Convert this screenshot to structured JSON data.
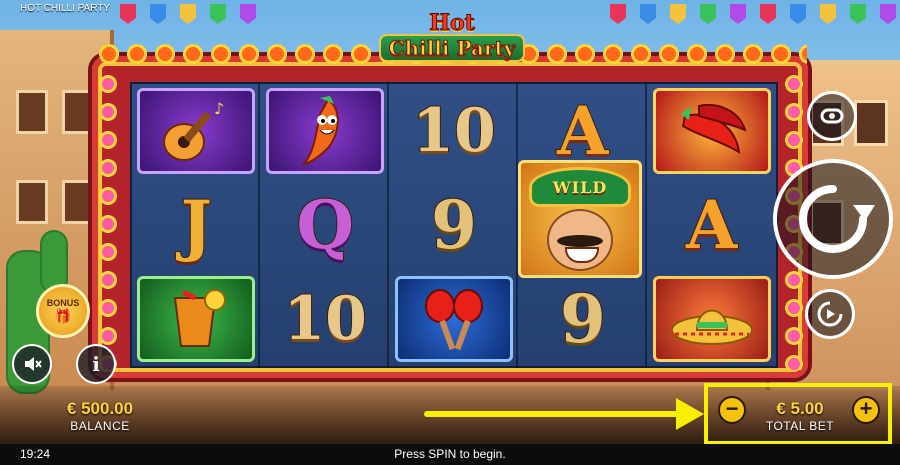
{
  "window": {
    "title": "HOT CHILLI PARTY"
  },
  "logo": {
    "line1": "Hot",
    "line2": "Chilli Party"
  },
  "reels": {
    "rows": [
      [
        "guitar",
        "chilli-pepper-character",
        "10",
        "A",
        "red-chillies"
      ],
      [
        "J",
        "Q",
        "9",
        "WILD",
        "A"
      ],
      [
        "tequila-cocktail",
        "10",
        "maracas",
        "9",
        "sombrero"
      ]
    ],
    "wild_label": "WILD"
  },
  "controls": {
    "bonus_label": "BONUS",
    "info_label": "i",
    "minus_label": "−",
    "plus_label": "+"
  },
  "balance": {
    "value": "€ 500.00",
    "label": "BALANCE"
  },
  "total_bet": {
    "value": "€ 5.00",
    "label": "TOTAL BET"
  },
  "status": {
    "time": "19:24",
    "message": "Press SPIN to begin."
  },
  "colors": {
    "highlight": "#f7f000",
    "money": "#ffd23a",
    "frame": "#b2232a"
  }
}
